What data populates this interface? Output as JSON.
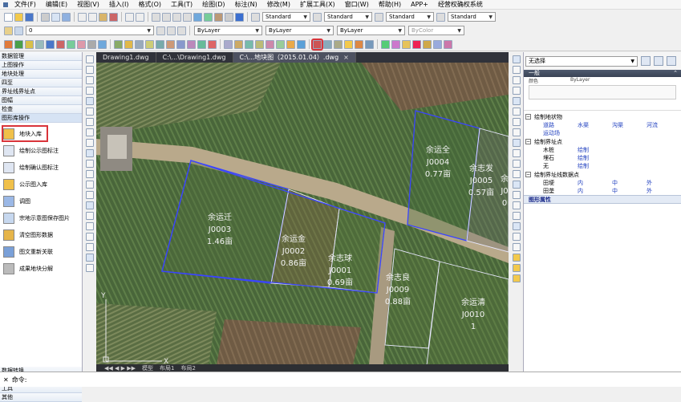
{
  "menubar": {
    "items": [
      "文件(F)",
      "编辑(E)",
      "视图(V)",
      "插入(I)",
      "格式(O)",
      "工具(T)",
      "绘图(D)",
      "标注(N)",
      "修改(M)",
      "扩展工具(X)",
      "窗口(W)",
      "帮助(H)",
      "APP+",
      "经营权确权系统"
    ]
  },
  "toolbar1": {
    "style_combos": [
      "Standard",
      "Standard",
      "Standard",
      "Standard"
    ]
  },
  "toolbar2": {
    "layer_combo": "0",
    "color_combo": "ByLayer",
    "linetype_combo": "ByLayer",
    "lineweight_combo": "ByLayer",
    "plotstyle_combo": "ByColor"
  },
  "left_panel": {
    "sections_top": [
      "数据管理",
      "上图操作",
      "地块处理",
      "四至",
      "界址线界址点",
      "图幅",
      "检查",
      "图形库操作"
    ],
    "items": [
      "地块入库",
      "绘制公示图标注",
      "绘制确认图标注",
      "公示图入库",
      "调图",
      "宗地示意图保存图片",
      "清空图形数据",
      "图文重新关联",
      "成果地块分解"
    ],
    "sections_bottom": [
      "数据转换",
      "标记",
      "工具",
      "其他"
    ]
  },
  "drawing": {
    "tabs": [
      "Drawing1.dwg",
      "C:\\...\\Drawing1.dwg",
      "C:\\...地块图（2015.01.04）.dwg"
    ],
    "layout_tabs": [
      "模型",
      "布局1",
      "布局2"
    ],
    "parcels": [
      {
        "owner": "余运迁",
        "code": "J0003",
        "area": "1.46亩"
      },
      {
        "owner": "余运金",
        "code": "J0002",
        "area": "0.86亩"
      },
      {
        "owner": "余志球",
        "code": "J0001",
        "area": "0.69亩"
      },
      {
        "owner": "余志良",
        "code": "J0009",
        "area": "0.88亩"
      },
      {
        "owner": "余运清",
        "code": "J0010",
        "area": "1"
      },
      {
        "owner": "余运全",
        "code": "J0004",
        "area": "0.77亩"
      },
      {
        "owner": "余志发",
        "code": "J0005",
        "area": "0.57亩"
      },
      {
        "owner": "余",
        "code": "J0",
        "area": "0"
      }
    ],
    "axis": {
      "x": "X",
      "y": "Y"
    }
  },
  "right_panel": {
    "select_label": "无选择",
    "section_general": "一般",
    "general_rows": [
      "颜色",
      "ByLayer"
    ],
    "tree": [
      {
        "title": "绘制地状物",
        "rows": [
          [
            "道路",
            "水渠",
            "沟渠",
            "河流"
          ],
          [
            "运动场",
            "",
            "",
            ""
          ]
        ]
      },
      {
        "title": "绘制界址点",
        "rows": [
          [
            "木桩",
            "绘制",
            "",
            ""
          ],
          [
            "埋石",
            "绘制",
            "",
            ""
          ],
          [
            "无",
            "绘制",
            "",
            ""
          ]
        ]
      },
      {
        "title": "绘制界址线数据点",
        "rows": [
          [
            "田埂",
            "内",
            "中",
            "外"
          ],
          [
            "田垄",
            "内",
            "中",
            "外"
          ]
        ]
      }
    ],
    "props_title": "图形属性"
  },
  "command": {
    "prompt": "命令:"
  },
  "colors": {
    "parcel_line": "#3a44ff",
    "accent_red": "#d9343a",
    "map_base": "#4f6a3e"
  }
}
